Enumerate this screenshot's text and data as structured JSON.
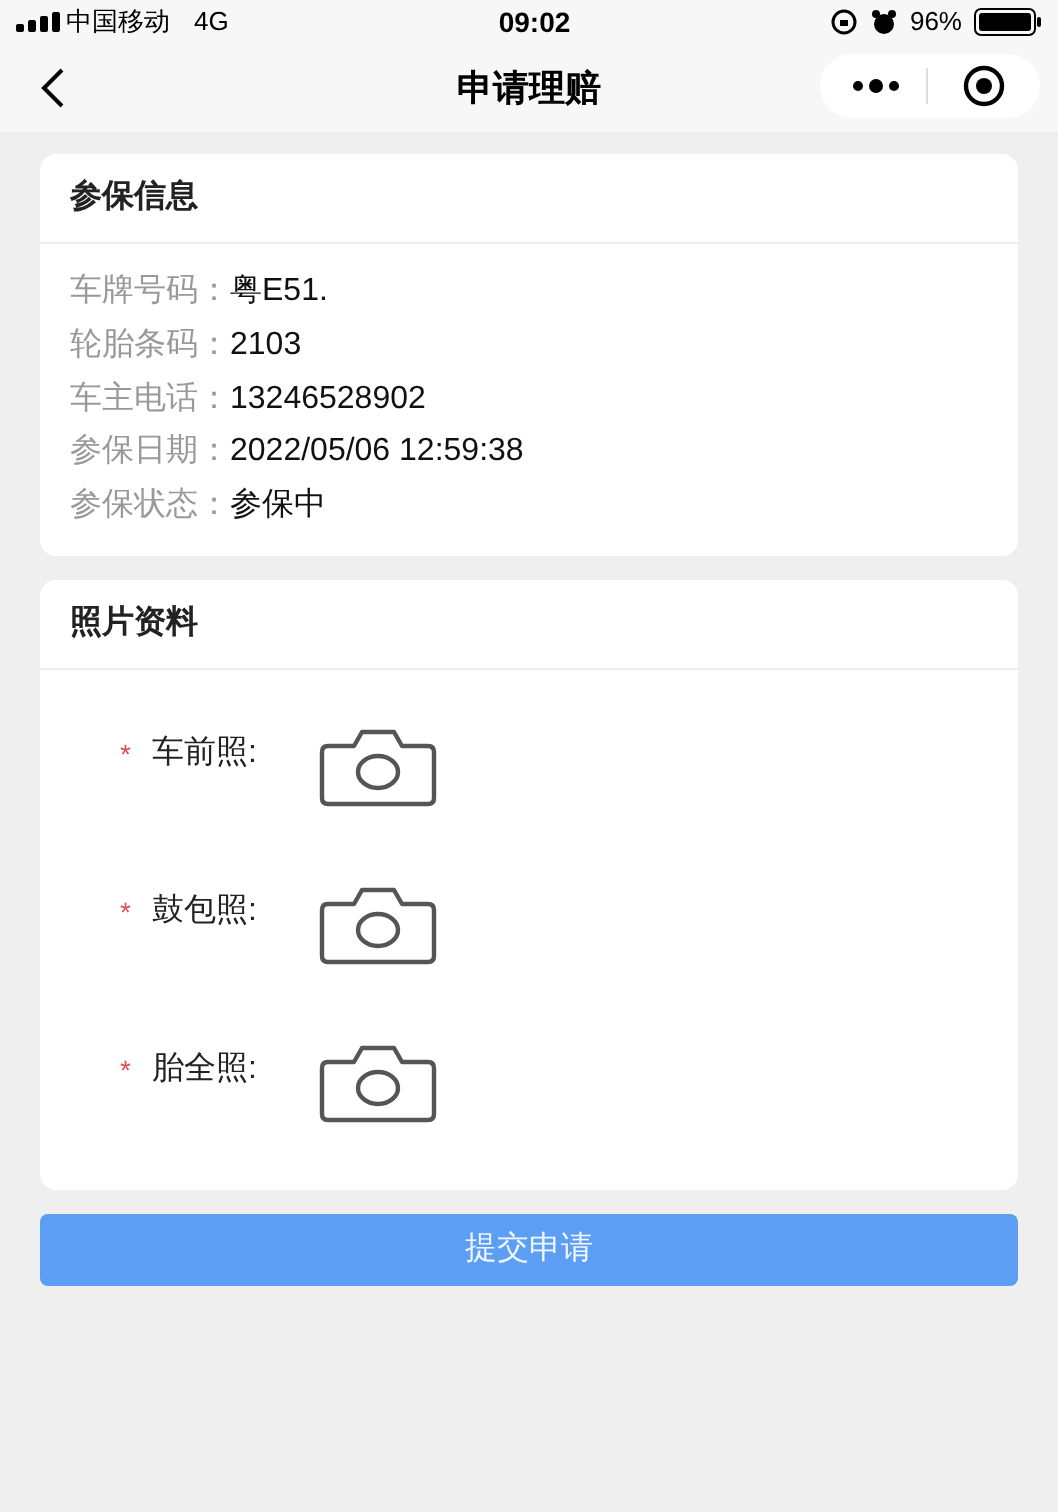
{
  "status_bar": {
    "carrier": "中国移动",
    "network": "4G",
    "time": "09:02",
    "battery": "96%"
  },
  "nav": {
    "title": "申请理赔"
  },
  "insurance_info": {
    "title": "参保信息",
    "rows": [
      {
        "label": "车牌号码：",
        "value": "粤E51."
      },
      {
        "label": "轮胎条码：",
        "value": "2103"
      },
      {
        "label": "车主电话：",
        "value": "13246528902"
      },
      {
        "label": "参保日期：",
        "value": "2022/05/06 12:59:38"
      },
      {
        "label": "参保状态：",
        "value": "参保中"
      }
    ]
  },
  "photos": {
    "title": "照片资料",
    "items": [
      {
        "mark": "*",
        "required": true,
        "label": "车前照:"
      },
      {
        "mark": "*",
        "required": true,
        "label": "鼓包照:"
      },
      {
        "mark": "*",
        "required": true,
        "label": "胎全照:"
      }
    ]
  },
  "submit_button": "提交申请"
}
